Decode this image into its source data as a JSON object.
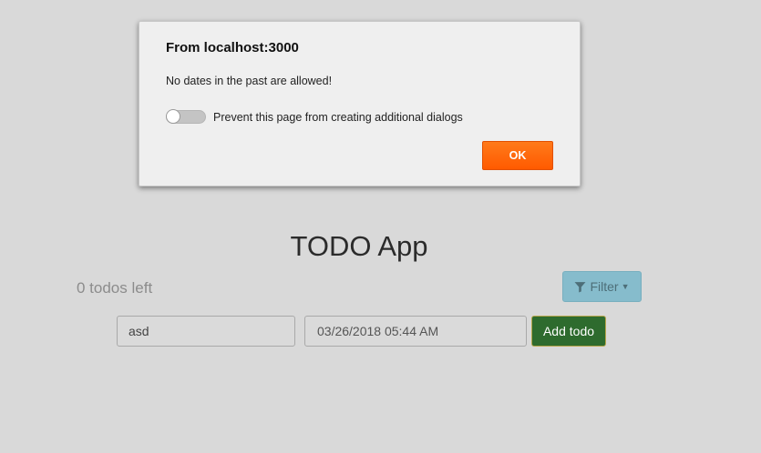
{
  "dialog": {
    "title": "From localhost:3000",
    "message": "No dates in the past are allowed!",
    "checkbox_label": "Prevent this page from creating additional dialogs",
    "checkbox_checked": false,
    "ok_label": "OK",
    "ok_color": "#ff6a0d"
  },
  "app": {
    "title": "TODO App",
    "todos_left": "0 todos left",
    "filter_label": "Filter",
    "filter_icon": "filter-icon",
    "filter_color": "#86bccc",
    "todo_input_value": "asd",
    "date_input_value": "03/26/2018 05:44 AM",
    "add_label": "Add todo",
    "add_color": "#2e6b2e"
  },
  "background_color": "#d9d9d9"
}
